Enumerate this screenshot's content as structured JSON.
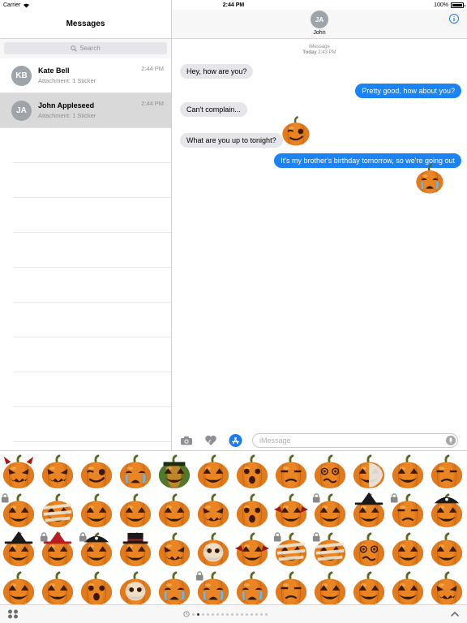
{
  "status_bar": {
    "carrier": "Carrier",
    "time": "2:44 PM",
    "battery": "100%",
    "battery_level": 1.0
  },
  "sidebar": {
    "title": "Messages",
    "search_placeholder": "Search",
    "conversations": [
      {
        "initials": "KB",
        "name": "Kate Bell",
        "preview": "Attachment: 1 Sticker",
        "time": "2:44 PM",
        "selected": false
      },
      {
        "initials": "JA",
        "name": "John Appleseed",
        "preview": "Attachment: 1 Sticker",
        "time": "2:44 PM",
        "selected": true
      }
    ]
  },
  "conversation": {
    "contact_initials": "JA",
    "contact_name": "John",
    "info_icon": "info-icon",
    "service_label": "iMessage",
    "date_label": "Today",
    "date_time": "2:43 PM",
    "messages": [
      {
        "from": "them",
        "text": "Hey, how are you?"
      },
      {
        "from": "me",
        "text": "Pretty good, how about you?"
      },
      {
        "from": "them",
        "text": "Can't complain..."
      },
      {
        "from": "them",
        "text": "What are you up to tonight?"
      },
      {
        "from": "me",
        "text": "It's my brother's birthday tomorrow, so we're going out"
      }
    ],
    "stickers": [
      {
        "face": "wink",
        "attached_to": "What are you up to tonight?"
      },
      {
        "face": "crying",
        "attached_to": "It's my brother's birthday tomorrow, so we're going out"
      }
    ]
  },
  "input_bar": {
    "camera_icon": "camera-icon",
    "digital_touch_icon": "heart-touch-icon",
    "app_store_icon": "app-store-icon",
    "placeholder": "iMessage",
    "mic_icon": "microphone-icon"
  },
  "sticker_drawer": {
    "rows": [
      [
        "devil",
        "angry",
        "wink",
        "crying",
        "frankenstein",
        "classic",
        "surprised",
        "unamused",
        "dizzy",
        "phantom",
        "squint",
        "frown"
      ],
      [
        "locked-smile",
        "mummy",
        "stitched",
        "grin",
        "laugh",
        "grimace",
        "tongue",
        "bat",
        "locked-grin",
        "witch",
        "locked-worried",
        "pirate"
      ],
      [
        "witch-hat-black",
        "witch-hat-red",
        "pirate-locked",
        "top-hat",
        "vampire",
        "skull",
        "bat-wings",
        "bandaged",
        "mummy-locked",
        "spiral",
        "grin-wide",
        "classic-2"
      ],
      [
        "smile",
        "smile",
        "open",
        "skeleton",
        "sad",
        "cry",
        "tear",
        "worried",
        "laugh",
        "laugh",
        "classic",
        "angry"
      ]
    ],
    "locked_cells": [
      [
        1,
        0
      ],
      [
        1,
        8
      ],
      [
        1,
        10
      ],
      [
        2,
        1
      ],
      [
        2,
        2
      ],
      [
        2,
        7
      ],
      [
        2,
        8
      ],
      [
        3,
        5
      ]
    ],
    "page_count": 16,
    "current_page": 1,
    "apps_icon": "apps-icon",
    "expand_icon": "chevron-up-icon",
    "recents_icon": "recents-icon"
  },
  "colors": {
    "bubble_out": "#1a84f7",
    "bubble_in": "#e5e5ea",
    "accent": "#1a7cf5",
    "pumpkin": "#e07a1c"
  }
}
